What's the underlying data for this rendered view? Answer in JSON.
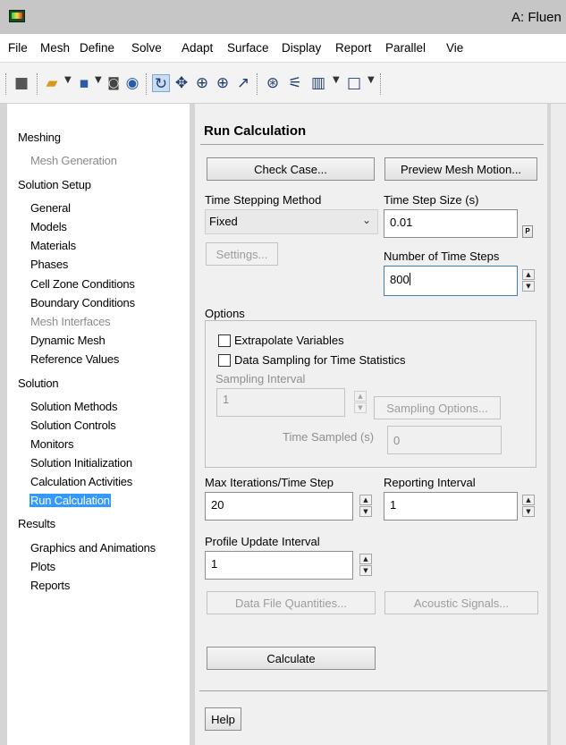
{
  "window": {
    "title": "A: Fluen"
  },
  "menu": [
    "File",
    "Mesh",
    "Define",
    "Solve",
    "Adapt",
    "Surface",
    "Display",
    "Report",
    "Parallel",
    "Vie"
  ],
  "toolbar_icons": [
    "read-case-icon",
    "open-folder-icon",
    "save-icon",
    "camera-icon",
    "help-icon",
    "rotate-icon",
    "pan-icon",
    "zoom-in-icon",
    "zoom-box-icon",
    "probe-icon",
    "fit-icon",
    "annotate-icon",
    "layout-icon",
    "view-icon"
  ],
  "nav": {
    "meshing": "Meshing",
    "mesh_generation": "Mesh Generation",
    "solution_setup": "Solution Setup",
    "general": "General",
    "models": "Models",
    "materials": "Materials",
    "phases": "Phases",
    "cell_zone": "Cell Zone Conditions",
    "boundary": "Boundary Conditions",
    "mesh_interfaces": "Mesh Interfaces",
    "dynamic_mesh": "Dynamic Mesh",
    "reference_values": "Reference Values",
    "solution": "Solution",
    "solution_methods": "Solution Methods",
    "solution_controls": "Solution Controls",
    "monitors": "Monitors",
    "solution_init": "Solution Initialization",
    "calc_activities": "Calculation Activities",
    "run_calculation": "Run Calculation",
    "results": "Results",
    "graphics": "Graphics and Animations",
    "plots": "Plots",
    "reports": "Reports"
  },
  "panel": {
    "title": "Run Calculation",
    "check_case": "Check Case...",
    "preview_mesh": "Preview Mesh Motion...",
    "time_stepping_label": "Time Stepping Method",
    "time_stepping_value": "Fixed",
    "time_step_size_label": "Time Step Size (s)",
    "time_step_size_value": "0.01",
    "param_button": "P",
    "settings": "Settings...",
    "num_steps_label": "Number of Time Steps",
    "num_steps_value": "800",
    "options_label": "Options",
    "extrapolate": "Extrapolate Variables",
    "data_sampling": "Data Sampling for Time Statistics",
    "sampling_interval_label": "Sampling Interval",
    "sampling_interval_value": "1",
    "sampling_options": "Sampling Options...",
    "time_sampled_label": "Time Sampled (s)",
    "time_sampled_value": "0",
    "max_iter_label": "Max Iterations/Time Step",
    "max_iter_value": "20",
    "reporting_label": "Reporting Interval",
    "reporting_value": "1",
    "profile_label": "Profile Update Interval",
    "profile_value": "1",
    "data_file_quantities": "Data File Quantities...",
    "acoustic_signals": "Acoustic Signals...",
    "calculate": "Calculate",
    "help": "Help"
  }
}
